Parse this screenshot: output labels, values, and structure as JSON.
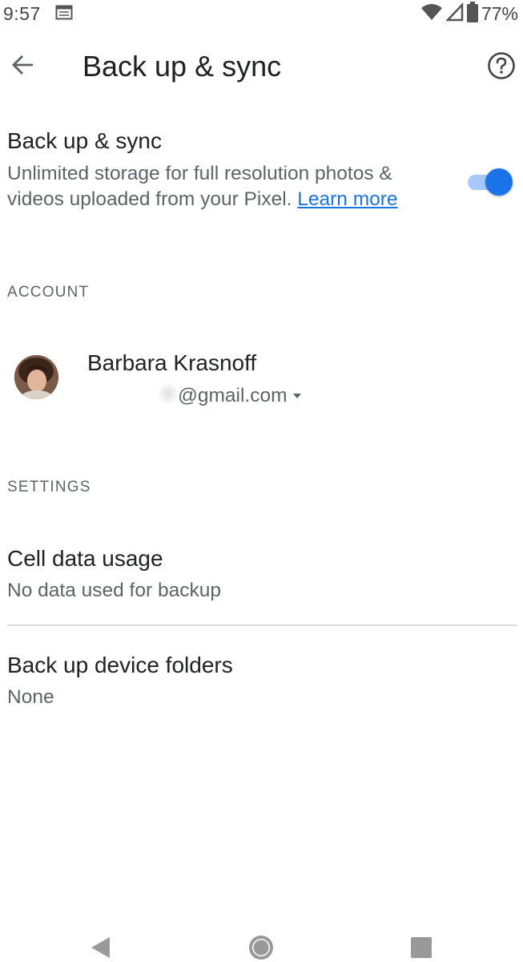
{
  "status_bar": {
    "time": "9:57",
    "battery_percent": "77%",
    "icons": [
      "calendar-notification-icon",
      "wifi-icon",
      "cell-signal-icon",
      "battery-icon"
    ]
  },
  "app_bar": {
    "title": "Back up & sync",
    "back_icon": "arrow-left-icon",
    "help_icon": "help-circle-icon"
  },
  "backup": {
    "title": "Back up & sync",
    "description": "Unlimited storage for full resolution photos & videos uploaded from your Pixel.",
    "learn_more": "Learn more",
    "enabled": true
  },
  "account": {
    "header": "ACCOUNT",
    "name": "Barbara Krasnoff",
    "email": "@gmail.com"
  },
  "settings": {
    "header": "SETTINGS",
    "cell_data": {
      "title": "Cell data usage",
      "subtitle": "No data used for backup"
    },
    "device_folders": {
      "title": "Back up device folders",
      "subtitle": "None"
    }
  },
  "nav": {
    "icons": [
      "nav-back-icon",
      "nav-home-icon",
      "nav-recents-icon"
    ]
  },
  "colors": {
    "accent": "#1a73e8",
    "accent_light": "#a6c8fb",
    "text_primary": "#202124",
    "text_secondary": "#5f6368",
    "divider": "#dadce0"
  }
}
